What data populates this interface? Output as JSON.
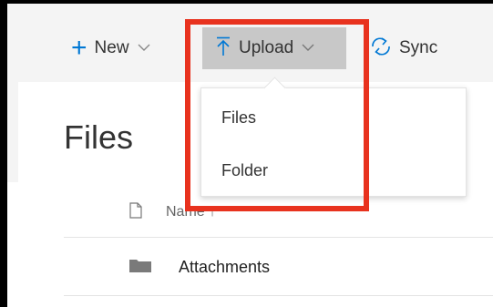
{
  "command_bar": {
    "new_label": "New",
    "upload_label": "Upload",
    "sync_label": "Sync"
  },
  "upload_menu": {
    "items": [
      {
        "label": "Files"
      },
      {
        "label": "Folder"
      }
    ]
  },
  "page": {
    "title": "Files"
  },
  "table": {
    "columns": [
      {
        "label": "Name",
        "sort": "ascending"
      }
    ],
    "rows": [
      {
        "name": "Attachments",
        "type": "folder"
      }
    ]
  },
  "icons": {
    "new": "plus-icon",
    "upload": "upload-arrow-icon",
    "sync": "sync-icon",
    "file_type": "file-type-icon",
    "folder": "folder-icon"
  },
  "colors": {
    "accent": "#0078d4",
    "highlight": "#e8321e",
    "upload_selected_bg": "#c8c8c8",
    "command_bar_bg": "#f4f4f4"
  }
}
